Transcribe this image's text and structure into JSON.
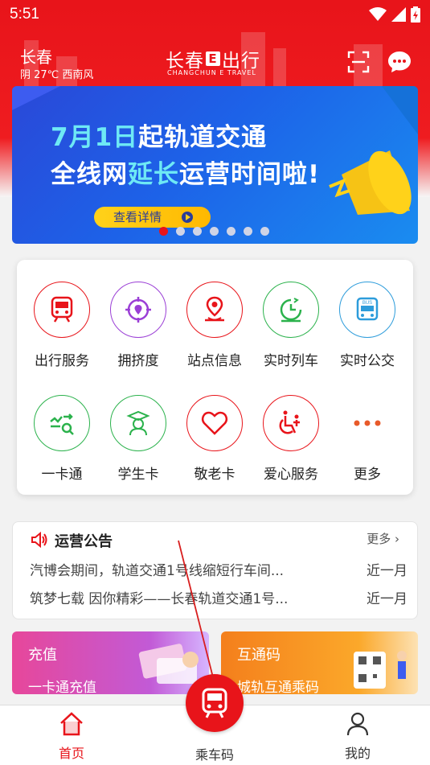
{
  "status_bar": {
    "time": "5:51"
  },
  "header": {
    "city": "长春",
    "weather": "阴 27℃ 西南风",
    "brand_left": "长春",
    "brand_e": "E",
    "brand_right": "出行",
    "brand_sub": "CHANGCHUN E TRAVEL"
  },
  "banner": {
    "line1_hl": "7月1日",
    "line1_rest": "起轨道交通",
    "line2_a": "全线网",
    "line2_hl": "延长",
    "line2_b": "运营时间啦!",
    "button": "查看详情",
    "pages": 7,
    "active_page": 1
  },
  "services": [
    {
      "label": "出行服务",
      "icon": "metro-train-icon",
      "color": "#e8141a"
    },
    {
      "label": "拥挤度",
      "icon": "crowd-location-icon",
      "color": "#9b3fd6"
    },
    {
      "label": "站点信息",
      "icon": "station-pin-icon",
      "color": "#e8141a"
    },
    {
      "label": "实时列车",
      "icon": "clock-icon",
      "color": "#2bb24c"
    },
    {
      "label": "实时公交",
      "icon": "bus-icon",
      "color": "#2d9cdb"
    },
    {
      "label": "一卡通",
      "icon": "card-swipe-icon",
      "color": "#2bb24c"
    },
    {
      "label": "学生卡",
      "icon": "student-icon",
      "color": "#2bb24c"
    },
    {
      "label": "敬老卡",
      "icon": "heart-icon",
      "color": "#e8141a"
    },
    {
      "label": "爱心服务",
      "icon": "accessibility-icon",
      "color": "#e8141a"
    },
    {
      "label": "更多",
      "icon": "more-dots-icon",
      "color": "#e8141a"
    }
  ],
  "notice": {
    "title": "运营公告",
    "more": "更多",
    "items": [
      {
        "text": "汽博会期间，轨道交通1号线缩短行车间...",
        "time": "近一月"
      },
      {
        "text": "筑梦七载 因你精彩——长春轨道交通1号...",
        "time": "近一月"
      }
    ]
  },
  "promos": [
    {
      "title": "充值",
      "subtitle": "一卡通充值"
    },
    {
      "title": "互通码",
      "subtitle": "城轨互通乘码"
    }
  ],
  "tabbar": {
    "home": "首页",
    "ride": "乘车码",
    "mine": "我的"
  },
  "colors": {
    "brand_red": "#e8141a",
    "banner_blue": "#1d62e8"
  }
}
